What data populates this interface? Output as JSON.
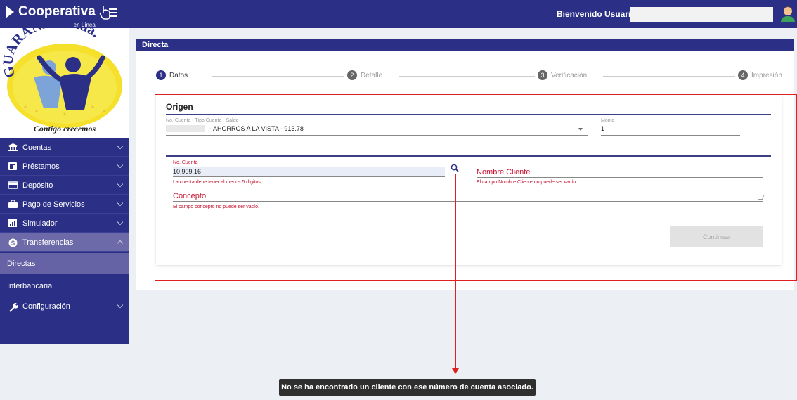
{
  "header": {
    "brand_title": "Cooperativa",
    "brand_subtitle": "en Línea",
    "welcome": "Bienvenido Usuario: E"
  },
  "sidebar": {
    "logo_name": "GUARANDA Ltda.",
    "logo_slogan": "Contigo crecemos",
    "items": [
      {
        "label": "Cuentas",
        "icon": "bank-icon"
      },
      {
        "label": "Préstamos",
        "icon": "loan-icon"
      },
      {
        "label": "Depósito",
        "icon": "card-icon"
      },
      {
        "label": "Pago de Servicios",
        "icon": "briefcase-icon"
      },
      {
        "label": "Simulador",
        "icon": "chart-icon"
      },
      {
        "label": "Transferencias",
        "icon": "dollar-icon"
      }
    ],
    "subitems": [
      {
        "label": "Directas",
        "active": true
      },
      {
        "label": "Interbancaria",
        "active": false
      }
    ],
    "config_label": "Configuración"
  },
  "panel": {
    "title": "Directa",
    "steps": [
      {
        "num": "1",
        "label": "Datos",
        "active": true
      },
      {
        "num": "2",
        "label": "Detalle",
        "active": false
      },
      {
        "num": "3",
        "label": "Verificación",
        "active": false
      },
      {
        "num": "4",
        "label": "Impresión",
        "active": false
      }
    ]
  },
  "form": {
    "section_title": "Origen",
    "origin_label": "No. Cuenta - Tipo Cuenta - Saldo",
    "origin_value": "- AHORROS A LA VISTA - 913.78",
    "monto_label": "Monto",
    "monto_value": "1",
    "cuenta_label": "No. Cuenta",
    "cuenta_value": "10,909.16",
    "cuenta_error": "La cuenta debe tener al menos 5 dígitos.",
    "nombre_label": "Nombre Cliente",
    "nombre_error": "El campo Nombre Cliente no puede ser vacío.",
    "concepto_label": "Concepto",
    "concepto_error": "El campo concepto no puede ser vacío.",
    "continue_label": "Continuar"
  },
  "toast": {
    "message": "No se ha encontrado un cliente con ese número de cuenta asociado."
  },
  "colors": {
    "primary": "#2b2f86",
    "error": "#c8102e",
    "annotation": "#e02020"
  }
}
